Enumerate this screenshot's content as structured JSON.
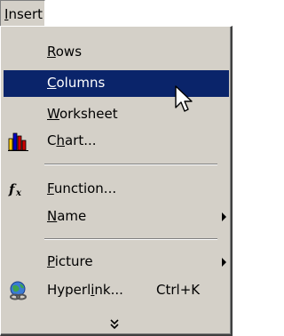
{
  "menubar": {
    "title": "Insert",
    "title_mnemonic": "I",
    "title_rest": "nsert"
  },
  "menu": {
    "items": [
      {
        "label": "Rows",
        "mnemonic": "R",
        "rest": "ows"
      },
      {
        "label": "Columns",
        "mnemonic": "C",
        "rest": "olumns",
        "state": "highlighted"
      },
      {
        "label": "Worksheet",
        "mnemonic": "W",
        "rest": "orksheet"
      },
      {
        "label": "Chart...",
        "pre": "C",
        "mnemonic": "h",
        "rest": "art...",
        "icon": "chart-icon"
      },
      {
        "label": "Function...",
        "mnemonic": "F",
        "rest": "unction...",
        "icon": "function-icon"
      },
      {
        "label": "Name",
        "mnemonic": "N",
        "rest": "ame",
        "submenu": true
      },
      {
        "label": "Picture",
        "mnemonic": "P",
        "rest": "icture",
        "submenu": true
      },
      {
        "label": "Hyperlink...",
        "pre": "Hyperl",
        "mnemonic": "i",
        "rest": "nk...",
        "shortcut": "Ctrl+K",
        "icon": "hyperlink-icon"
      }
    ],
    "expand_icon": "double-chevron-down-icon"
  },
  "colors": {
    "menu_background": "#d4d0c8",
    "highlight_background": "#0a246a",
    "highlight_text": "#ffffff"
  },
  "cursor_icon": "arrow-cursor-icon"
}
